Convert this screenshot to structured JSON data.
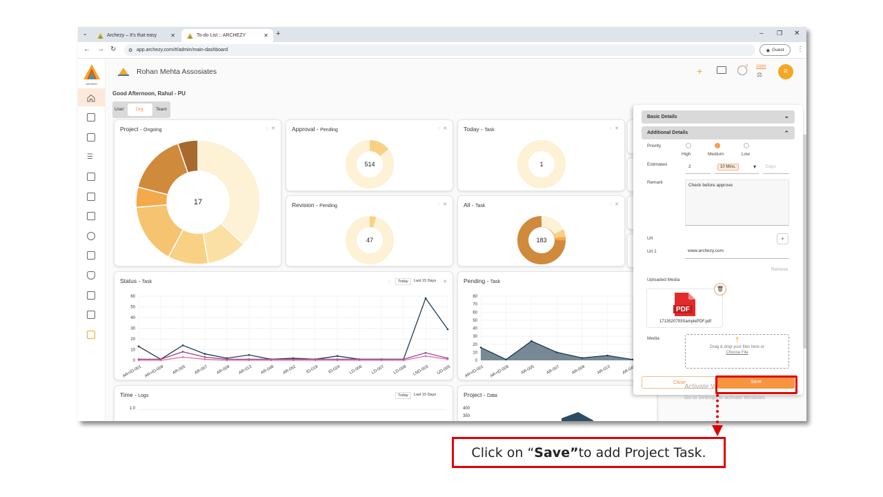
{
  "browser": {
    "tabs": [
      {
        "title": "Archezy – It's that easy"
      },
      {
        "title": "To-do List :: ARCHEZY"
      }
    ],
    "url": "app.archezy.com/#/admin/main-dashboard",
    "profile_label": "Guest"
  },
  "app": {
    "company_name": "Rohan Mehta Assosiates",
    "greeting": "Good Afternoon, Rahul - PU",
    "view_toggle": [
      "User",
      "Org.",
      "Team"
    ],
    "active_view": "Org.",
    "header_badge_count": "0",
    "header_coins": "2080",
    "avatar_letter": "R",
    "logo_text": "ARCHEZY",
    "accent_color": "#f08a3a"
  },
  "cards": {
    "project": {
      "title": "Project",
      "subtitle": "Ongoing",
      "center": "17"
    },
    "approval": {
      "title": "Approval",
      "subtitle": "Pending",
      "center": "514"
    },
    "today": {
      "title": "Today",
      "subtitle": "Task",
      "center": "1"
    },
    "revision": {
      "title": "Revision",
      "subtitle": "Pending",
      "center": "47"
    },
    "all": {
      "title": "All",
      "subtitle": "Task",
      "center": "183"
    },
    "status": {
      "title": "Status",
      "subtitle": "Task",
      "range_today": "Today",
      "range_15": "Last 15 Days"
    },
    "pending": {
      "title": "Pending",
      "subtitle": "Task"
    },
    "time": {
      "title": "Time",
      "subtitle": "Logs",
      "range_today": "Today",
      "range_15": "Last 15 Days",
      "ytick_top": "1.0"
    },
    "projectdata": {
      "title": "Project",
      "subtitle": "Data",
      "ytick_400": "400",
      "ytick_350": "350"
    }
  },
  "chart_data": [
    {
      "type": "pie",
      "title": "Project - Ongoing",
      "center_label": "17",
      "values": [
        7,
        2,
        2,
        3,
        1,
        3,
        1
      ],
      "colors": [
        "#fdf1d6",
        "#fbe0a4",
        "#f8d185",
        "#f6c370",
        "#f4a94b",
        "#d08a3c",
        "#a8692e"
      ]
    },
    {
      "type": "line",
      "title": "Status - Task",
      "categories": [
        "AR+ID-001",
        "AR+ID-009",
        "AR-005",
        "AR-007",
        "AR-009",
        "AR-013",
        "AR-048",
        "AR-052",
        "ID-019",
        "ID-024",
        "LD-006",
        "LD-007",
        "LD-008",
        "LND-003",
        "UD-005"
      ],
      "ylim": [
        0,
        60
      ],
      "yticks": [
        0,
        10,
        20,
        30,
        40,
        50,
        60
      ],
      "series": [
        {
          "color": "#1c3a4f",
          "values": [
            13,
            1,
            14,
            6,
            2,
            5,
            1,
            2,
            1,
            4,
            1,
            1,
            1,
            58,
            29
          ]
        },
        {
          "color": "#9b3f8c",
          "values": [
            1,
            1,
            8,
            3,
            1,
            1,
            1,
            1,
            1,
            1,
            1,
            1,
            1,
            7,
            2
          ]
        },
        {
          "color": "#e06e9e",
          "values": [
            0,
            0,
            3,
            1,
            0,
            0,
            0,
            0,
            0,
            0,
            0,
            0,
            0,
            4,
            1
          ]
        }
      ]
    },
    {
      "type": "area",
      "title": "Pending - Task",
      "categories": [
        "AR+ID-001",
        "AR+ID-009",
        "AR-005",
        "AR-007",
        "AR-009",
        "AR-013",
        "AR-048",
        "AR-05"
      ],
      "ylim": [
        0,
        80
      ],
      "yticks": [
        0,
        10,
        20,
        30,
        40,
        50,
        60,
        70,
        80
      ],
      "series": [
        {
          "color": "#1c3a4f",
          "values": [
            16,
            1,
            24,
            10,
            3,
            6,
            1,
            2
          ]
        }
      ]
    }
  ],
  "panel": {
    "basic_details": "Basic Details",
    "additional_details": "Additional Details",
    "priority_label": "Priority",
    "priority_options": [
      "High",
      "Medium",
      "Low"
    ],
    "priority_selected": "Medium",
    "estimated_label": "Estimated",
    "estimated_value": "2",
    "estimated_unit": "10 Mins.",
    "days_placeholder": "Days",
    "remark_label": "Remark",
    "remark_value": "Check before approve",
    "url_label": "Url",
    "url1_label": "Url 1",
    "url1_value": "www.archezy.com",
    "remove_label": "Remove",
    "uploaded_media_label": "Uploaded Media",
    "pdf_label": "PDF",
    "file_name": "1713520793SamplePDF.pdf",
    "media_label": "Media",
    "drop_text": "Drag & drop your files here or",
    "choose_file": "Choose File",
    "close_button": "Close",
    "save_button": "Save"
  },
  "windows_notice": {
    "line1": "Activate W",
    "line2": "Go to Settings to activate Windows."
  },
  "callout": {
    "prefix": "Click on “",
    "bold": "Save”",
    "suffix": " to add Project Task."
  }
}
